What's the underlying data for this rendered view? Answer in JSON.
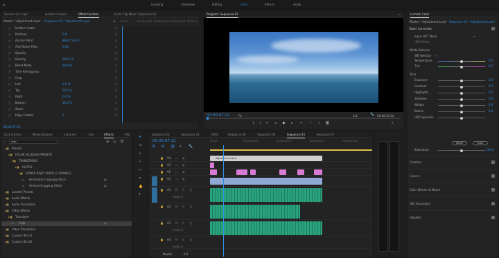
{
  "colors": {
    "accent": "#2f8fe5",
    "audio_green": "#29a37e",
    "video_blue": "#8fa9d4",
    "video_pink": "#d77bd6",
    "adjust_layer": "#cfcfcf",
    "playhead": "#2f8fe5",
    "time_yellow": "#e0c14a"
  },
  "workspaces": [
    "Learning",
    "Assembly",
    "Editing",
    "Color",
    "Effects",
    "Audio"
  ],
  "workspace_active": "Color",
  "source_panel": {
    "tabs": [
      "Source: (no clips)",
      "Lumetri Scopes",
      "Effect Controls",
      "Audio Clip Mixer: Sequence 03"
    ],
    "active_tab": "Effect Controls",
    "master_label": "Master * Adjustment Layer",
    "sequence_label": "Sequence 03 * Adjustment Layer",
    "ruler_times": [
      "00:00",
      "00:00:04:23",
      "00:00:09:23",
      "00:00:14:22",
      "00:00:19:2"
    ],
    "props": [
      {
        "name": "Uniform Scale",
        "value": ""
      },
      {
        "name": "Rotation",
        "value": "0.0"
      },
      {
        "name": "Anchor Point",
        "value": "960.0    540.0"
      },
      {
        "name": "Anti-flicker Filter",
        "value": "0.00"
      },
      {
        "name": "Opacity",
        "value": ""
      },
      {
        "name": "Opacity",
        "value": "100.0 %"
      },
      {
        "name": "Blend Mode",
        "value": "Normal"
      },
      {
        "name": "Time Remapping",
        "value": ""
      },
      {
        "name": "Crop",
        "value": ""
      },
      {
        "name": "Left",
        "value": "0.0 %"
      },
      {
        "name": "Top",
        "value": "10.0 %"
      },
      {
        "name": "Right",
        "value": "0.0 %"
      },
      {
        "name": "Bottom",
        "value": "10.0 %"
      },
      {
        "name": "Zoom",
        "value": ""
      },
      {
        "name": "Edge Feather",
        "value": "0"
      }
    ],
    "timecode": "00:00:07:12"
  },
  "program": {
    "title": "Program: Sequence 03",
    "timecode": "00:00:07:12",
    "fit": "Fit",
    "quality": "1/4",
    "duration": "00:00:34:04"
  },
  "project_panel": {
    "tabs": [
      "Lock Frames",
      "Media Browser",
      "Libraries",
      "Info",
      "Effects",
      "Mar"
    ],
    "active_tab": "Effects",
    "search_value": "crop",
    "items": [
      {
        "indent": 1,
        "label": "Presets",
        "type": "folder"
      },
      {
        "indent": 2,
        "label": "DYLAN VILLEGAS PRESETS",
        "type": "folder"
      },
      {
        "indent": 3,
        "label": "TRANSITIONS",
        "type": "folder"
      },
      {
        "indent": 4,
        "label": "GLITCH",
        "type": "folder"
      },
      {
        "indent": 5,
        "label": "LOWER RISKY VIDEO (2 FRAMES)",
        "type": "folder"
      },
      {
        "indent": 6,
        "label": "Horizontal Cropping Glitch",
        "type": "effect"
      },
      {
        "indent": 6,
        "label": "Vertical Cropping Glitch",
        "type": "effect"
      },
      {
        "indent": 1,
        "label": "Lumetri Presets",
        "type": "folder"
      },
      {
        "indent": 1,
        "label": "Audio Effects",
        "type": "folder"
      },
      {
        "indent": 1,
        "label": "Audio Transitions",
        "type": "folder"
      },
      {
        "indent": 1,
        "label": "Video Effects",
        "type": "folder"
      },
      {
        "indent": 2,
        "label": "Transform",
        "type": "folder"
      },
      {
        "indent": 3,
        "label": "Crop",
        "type": "effect",
        "selected": true
      },
      {
        "indent": 1,
        "label": "Video Transitions",
        "type": "folder"
      },
      {
        "indent": 1,
        "label": "Custom Bin 01",
        "type": "folder"
      },
      {
        "indent": 1,
        "label": "Custom Bin 02",
        "type": "folder"
      }
    ]
  },
  "timeline": {
    "tabs": [
      "Sequence 01",
      "Sequence 02",
      "TERS",
      "Sequence 06",
      "Sequence 08",
      "Sequence 03",
      "Sequence 07"
    ],
    "active_tab": "Sequence 03",
    "timecode": "00:00:07:12",
    "ruler": [
      "00:00",
      "00:00:04:23",
      "00:00:09:23",
      "00:00:14:22",
      "00:00:19:22"
    ],
    "tracks": [
      "V4",
      "V3",
      "V2",
      "V1",
      "A1",
      "A2",
      "A3",
      "A4"
    ],
    "track_names": {
      "A1": "Audio 1",
      "A3": "Audio 3",
      "A4": "Audio 4"
    },
    "adjustment_clip": "Adjustment Layer",
    "master_label": "Master",
    "master_value": "0.0"
  },
  "lumetri": {
    "title": "Lumetri Color",
    "master_label": "Master * Adjustment Layer",
    "seq_label": "Sequence 03 * Adjustment Layer",
    "basic": "Basic Correction",
    "input_lut_label": "Input LUT",
    "input_lut_value": "None",
    "hdr_label": "HDR White",
    "white_balance": "White Balance",
    "wb_selector": "WB Selector",
    "temperature": {
      "label": "Temperature",
      "value": "0.0",
      "pos": 0.5
    },
    "tint": {
      "label": "Tint",
      "value": "0.0",
      "pos": 0.5
    },
    "tone": "Tone",
    "tones": [
      {
        "label": "Exposure",
        "value": "0.0",
        "pos": 0.5
      },
      {
        "label": "Contrast",
        "value": "0.0",
        "pos": 0.5
      },
      {
        "label": "Highlights",
        "value": "0.0",
        "pos": 0.5
      },
      {
        "label": "Shadows",
        "value": "0.0",
        "pos": 0.5
      },
      {
        "label": "Whites",
        "value": "0.0",
        "pos": 0.5
      },
      {
        "label": "Blacks",
        "value": "0.0",
        "pos": 0.5
      },
      {
        "label": "HDR Specular",
        "value": "",
        "pos": 0.5
      }
    ],
    "reset": "Reset",
    "auto": "Auto",
    "saturation": {
      "label": "Saturation",
      "value": "100.0",
      "pos": 0.5
    },
    "sections": [
      "Creative",
      "Curves",
      "Color Wheels & Match",
      "HSL Secondary",
      "Vignette"
    ]
  }
}
